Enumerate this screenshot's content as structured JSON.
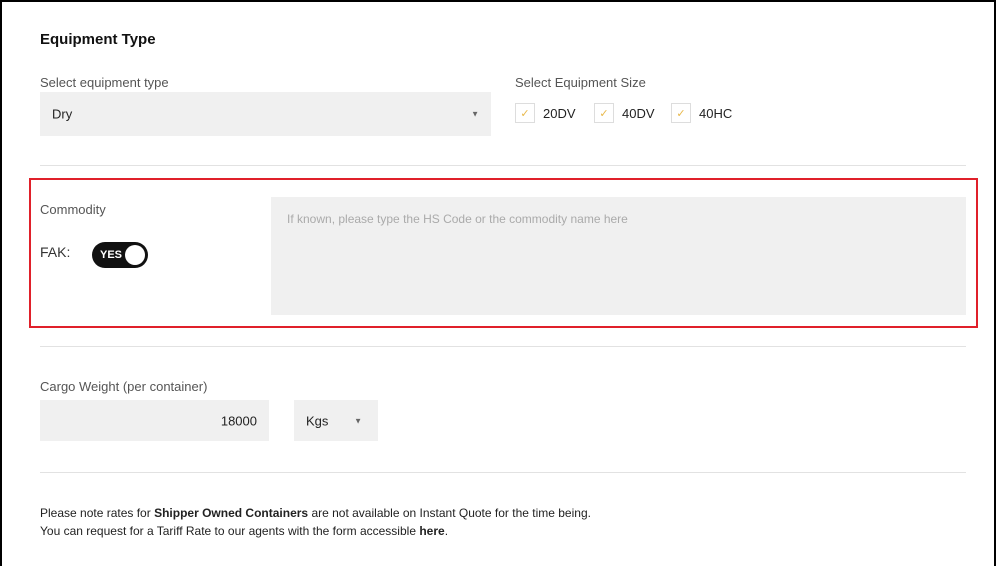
{
  "equipment": {
    "title": "Equipment Type",
    "type_label": "Select equipment type",
    "type_value": "Dry",
    "size_label": "Select Equipment Size",
    "sizes": [
      {
        "label": "20DV",
        "checked": true
      },
      {
        "label": "40DV",
        "checked": true
      },
      {
        "label": "40HC",
        "checked": true
      }
    ]
  },
  "commodity": {
    "label": "Commodity",
    "fak_label": "FAK:",
    "fak_toggle": "YES",
    "placeholder": "If known, please type the HS Code or the commodity name here"
  },
  "cargo": {
    "label": "Cargo Weight (per container)",
    "weight_value": "18000",
    "unit_value": "Kgs"
  },
  "note": {
    "line1_pre": "Please note rates for ",
    "line1_bold": "Shipper Owned Containers",
    "line1_post": " are not available on Instant Quote for the time being.",
    "line2_pre": "You can request for a Tariff Rate to our agents with the form accessible ",
    "line2_link": "here",
    "line2_post": "."
  },
  "colors": {
    "highlight": "#e0202a",
    "checkmark": "#e8b84a",
    "toggle_on": "#111111"
  }
}
